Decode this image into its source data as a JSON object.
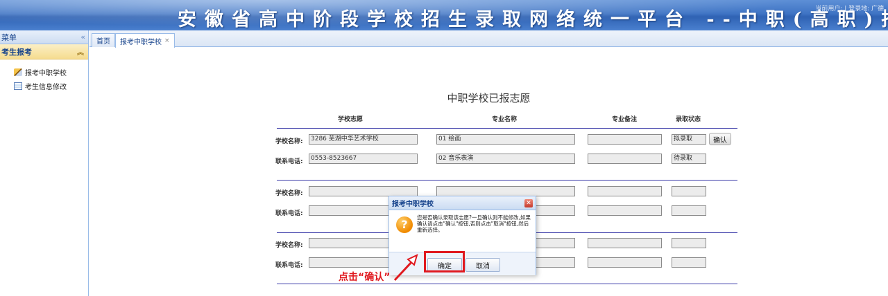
{
  "banner": {
    "title": "安徽省高中阶段学校招生录取网络统一平台 --中职(高职)招生录取",
    "user_info": "当前用户: | 登录地: 广德"
  },
  "sidebar": {
    "menu_label": "菜单",
    "collapse_icon": "double-chevron-left-icon",
    "group_label": "考生报考",
    "group_toggle_icon": "double-chevron-up-icon",
    "items": [
      {
        "label": "报考中职学校",
        "icon": "pencil-icon"
      },
      {
        "label": "考生信息修改",
        "icon": "form-icon"
      }
    ]
  },
  "tabs": [
    {
      "label": "首页"
    },
    {
      "label": "报考中职学校",
      "close": "×"
    }
  ],
  "main": {
    "title": "中职学校已报志愿",
    "columns": [
      "学校志愿",
      "专业名称",
      "专业备注",
      "录取状态"
    ],
    "labels": {
      "school": "学校名称:",
      "phone": "联系电话:"
    },
    "groups": [
      {
        "school_value": "3286 芜湖中华艺术学校",
        "phone_value": "0553-8523667",
        "major1": "01 绘画",
        "major2": "02 音乐表演",
        "remark1": "",
        "remark2": "",
        "status1": "拟录取",
        "status2": "待录取",
        "confirm_label": "确认"
      },
      {
        "school_value": "",
        "phone_value": ""
      },
      {
        "school_value": "",
        "phone_value": ""
      }
    ]
  },
  "dialog": {
    "title": "报考中职学校",
    "message": "您是否确认录取该志愿?一旦确认则不能修改,如果确认请点击\"确认\"按钮,否则点击\"取消\"按钮,然后重新选择。",
    "ok_label": "确定",
    "cancel_label": "取消"
  },
  "annotation": {
    "text": "点击“确认”",
    "color": "#e0191f"
  },
  "colors": {
    "accent": "#15428b",
    "border": "#99bbe8",
    "highlight": "#e0191f"
  }
}
